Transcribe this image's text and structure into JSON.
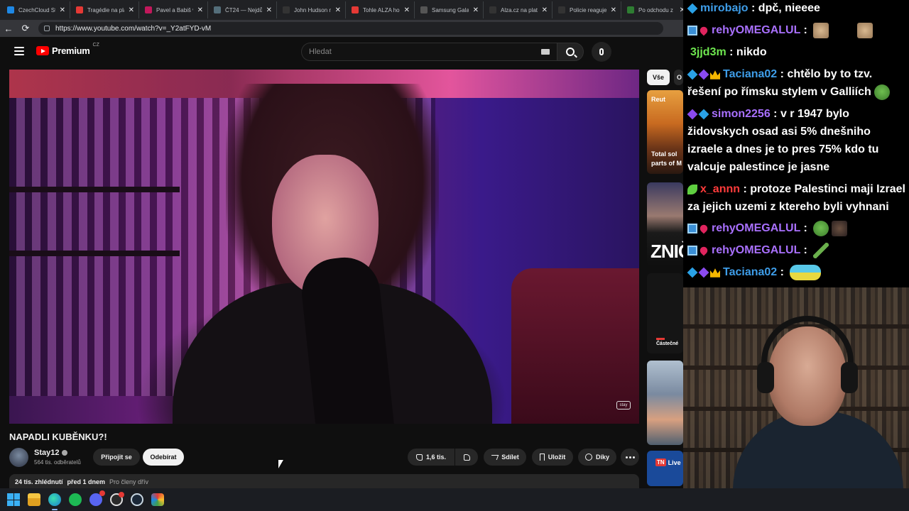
{
  "browser": {
    "tabs": [
      {
        "label": "CzechCloud St",
        "color": "#1e88e5"
      },
      {
        "label": "Tragédie na pla",
        "color": "#e53935"
      },
      {
        "label": "Pavel a Babiš v",
        "color": "#c2185b"
      },
      {
        "label": "ČT24 — Nejdů",
        "color": "#546e7a"
      },
      {
        "label": "John Hudson n",
        "color": "#333333"
      },
      {
        "label": "Tohle ALZA ho",
        "color": "#e53935"
      },
      {
        "label": "Samsung Galax",
        "color": "#555555"
      },
      {
        "label": "Alza.cz na platf",
        "color": "#333333"
      },
      {
        "label": "Policie reaguje",
        "color": "#333333"
      },
      {
        "label": "Po odchodu z",
        "color": "#2e7d32"
      }
    ],
    "close_glyph": "✕",
    "back_glyph": "←",
    "reload_glyph": "⟳",
    "url": "https://www.youtube.com/watch?v=_Y2atFYD-vM"
  },
  "youtube": {
    "logo_text": "Premium",
    "logo_country": "CZ",
    "search_placeholder": "Hledat",
    "video_title": "NAPADLI KUBĚNKU?!",
    "channel_name": "Stay12",
    "channel_subs": "564 tis. odběratelů",
    "join_label": "Připojit se",
    "subscribe_label": "Odebírat",
    "like_count": "1,6 tis.",
    "share_label": "Sdílet",
    "save_label": "Uložit",
    "thanks_label": "Díky",
    "views": "24 tis. zhlédnutí",
    "posted": "před 1 dnem",
    "members_only": "Pro členy dřív",
    "watermark": "stay",
    "chips": [
      "Vše",
      "O"
    ],
    "sidebar": {
      "thumb1_source": "Reut",
      "thumb1_caption_1": "Total sol",
      "thumb1_caption_2": "parts of M",
      "thumb2_word": "ZNIČ",
      "thumb3_caption": "Částečné",
      "thumb5_badge": "TN",
      "thumb5_label": "Live"
    }
  },
  "chat": {
    "messages": [
      {
        "user": "mirobajo",
        "text": "dpč, nieeee"
      },
      {
        "user": "rehyOMEGALUL",
        "text": ""
      },
      {
        "user": "3jjd3m",
        "text": "nikdo"
      },
      {
        "user": "Taciana02",
        "text": "chtělo by to tzv. řešení po římsku stylem v Galliích"
      },
      {
        "user": "simon2256",
        "text": "v r 1947 bylo židovskych osad asi 5% dnešniho izraele a dnes je to pres 75% kdo tu valcuje palestince je jasne"
      },
      {
        "user": "x_annn",
        "text": "protoze Palestinci maji Izrael za jejich uzemi z ktereho byli vyhnani"
      },
      {
        "user": "rehyOMEGALUL",
        "text": ""
      },
      {
        "user": "rehyOMEGALUL",
        "text": ""
      },
      {
        "user": "Taciana02",
        "text": ""
      }
    ],
    "separator": ":"
  },
  "colors": {
    "youtube_red": "#ff0000",
    "chat_blue_user": "#3e9de8",
    "chat_purple_user": "#a970ff",
    "chat_green_user": "#6ee64f",
    "chat_red_user": "#ff3b3b"
  },
  "taskbar": {
    "icons": [
      "windows-icon",
      "file-explorer-icon",
      "edge-icon",
      "spotify-icon",
      "discord-icon",
      "obs-icon",
      "steam-icon",
      "colorful-app-icon"
    ]
  }
}
